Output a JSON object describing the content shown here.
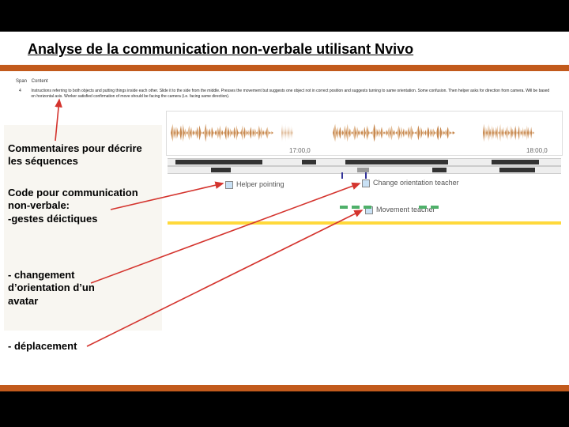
{
  "title": "Analyse de la communication non-verbale utilisant Nvivo",
  "table": {
    "col_span": "Span",
    "col_content": "Content",
    "row_id": "4",
    "row_text": "Instructions referring to both objects and putting things inside each other. Slide it to the side from the middle. Presses the movement but suggests one object not in correct position and suggests turning to same orientation. Some confusion. Then helper asks for direction from camera. Will be based on horizontal axis. Worker satisfied confirmation of move should be facing the camera (i.e. facing same direction)."
  },
  "timeline": {
    "t1": "17:00,0",
    "t2": "18:00,0"
  },
  "codes": {
    "c1": "Helper pointing",
    "c2": "Change orientation teacher",
    "c3": "Movement teacher"
  },
  "annotations": {
    "a1": "Commentaires pour décrire les séquences",
    "a2": "Code pour communication non-verbale:\n-gestes déictiques",
    "a3": "- changement d’orientation d’un avatar",
    "a4": "- déplacement"
  }
}
